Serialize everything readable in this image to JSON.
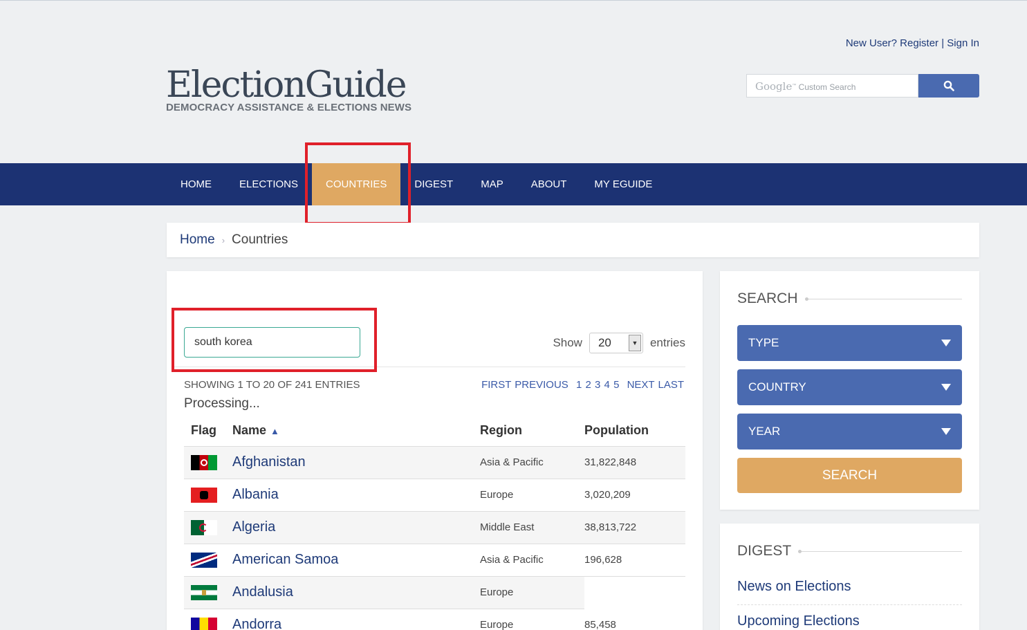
{
  "header": {
    "register_label": "New User? Register",
    "separator": "|",
    "signin_label": "Sign In",
    "logo_main": "ElectionGuide",
    "logo_sub": "DEMOCRACY ASSISTANCE & ELECTIONS NEWS",
    "search_brand": "Google",
    "search_placeholder": "Custom Search"
  },
  "nav": {
    "items": [
      "HOME",
      "ELECTIONS",
      "COUNTRIES",
      "DIGEST",
      "MAP",
      "ABOUT",
      "MY EGUIDE"
    ],
    "active": "COUNTRIES"
  },
  "breadcrumb": {
    "home": "Home",
    "separator": "›",
    "current": "Countries"
  },
  "table_controls": {
    "filter_value": "south korea",
    "show_label": "Show",
    "entries_value": "20",
    "entries_label": "entries",
    "info": "SHOWING 1 TO 20 OF 241 ENTRIES",
    "pager": {
      "first": "FIRST",
      "previous": "PREVIOUS",
      "pages": [
        "1",
        "2",
        "3",
        "4",
        "5"
      ],
      "next": "NEXT",
      "last": "LAST"
    },
    "processing": "Processing..."
  },
  "table": {
    "columns": {
      "flag": "Flag",
      "name": "Name",
      "sort_indicator": "▲",
      "region": "Region",
      "population": "Population"
    },
    "rows": [
      {
        "name": "Afghanistan",
        "region": "Asia & Pacific",
        "population": "31,822,848"
      },
      {
        "name": "Albania",
        "region": "Europe",
        "population": "3,020,209"
      },
      {
        "name": "Algeria",
        "region": "Middle East",
        "population": "38,813,722"
      },
      {
        "name": "American Samoa",
        "region": "Asia & Pacific",
        "population": "196,628"
      },
      {
        "name": "Andalusia",
        "region": "Europe",
        "population": ""
      },
      {
        "name": "Andorra",
        "region": "Europe",
        "population": "85,458"
      }
    ]
  },
  "sidebar": {
    "search_title": "SEARCH",
    "type_label": "TYPE",
    "country_label": "COUNTRY",
    "year_label": "YEAR",
    "search_button": "SEARCH",
    "digest_title": "DIGEST",
    "digest_links": [
      "News on Elections",
      "Upcoming Elections"
    ]
  },
  "colors": {
    "nav_bg": "#1c3273",
    "active_tab": "#dfa862",
    "dropdown_bg": "#4a6ab0",
    "link": "#1e3a78",
    "highlight_box": "#e0202a"
  }
}
